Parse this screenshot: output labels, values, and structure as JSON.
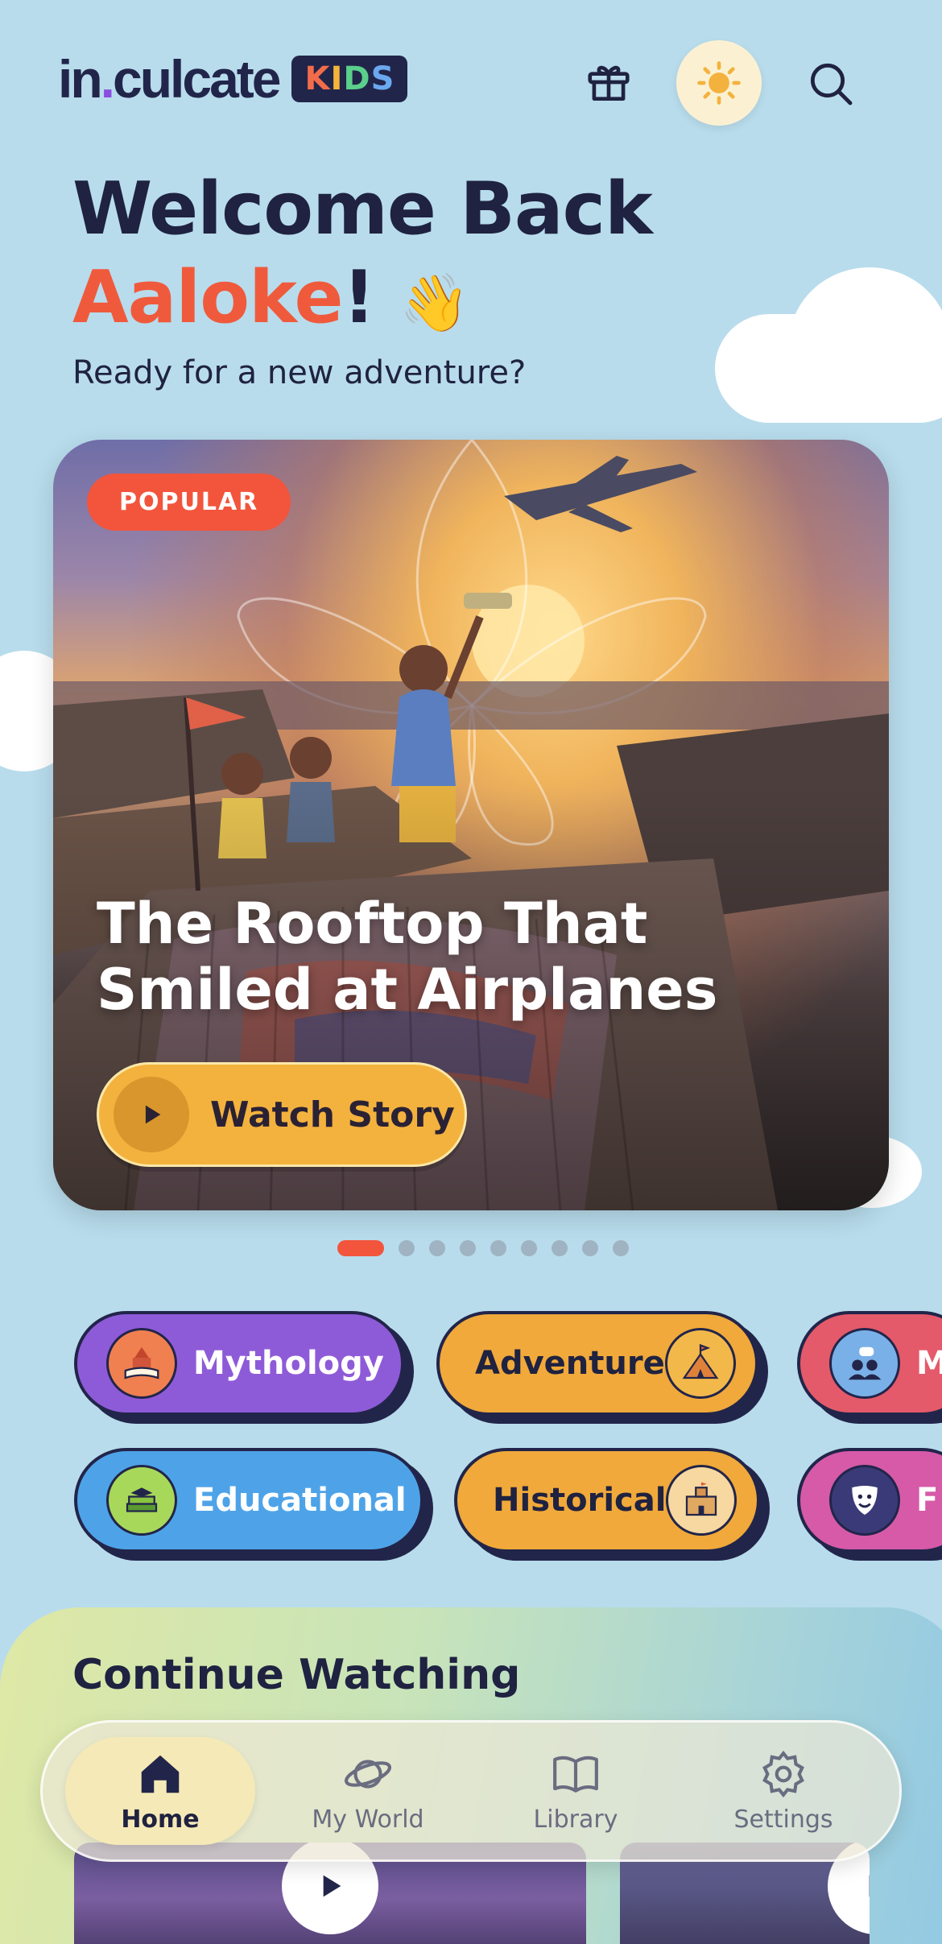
{
  "header": {
    "logo_main": "in",
    "logo_dot": ".",
    "logo_rest": "culcate",
    "logo_badge": [
      "K",
      "I",
      "D",
      "S"
    ],
    "icons": [
      "gift-icon",
      "sun-icon",
      "search-icon"
    ]
  },
  "welcome": {
    "line1": "Welcome Back",
    "name": "Aaloke",
    "exclaim": "!",
    "wave": "👋",
    "subtitle": "Ready for a new adventure?"
  },
  "hero": {
    "badge": "POPULAR",
    "title": "The Rooftop That Smiled at Airplanes",
    "button_label": "Watch Story",
    "carousel_pages": 9,
    "carousel_active_index": 0
  },
  "categories": {
    "mythology": "Mythology",
    "adventure": "Adventure",
    "third_partial": "M",
    "educational": "Educational",
    "historical": "Historical",
    "sixth_partial": "F"
  },
  "continue_watching": {
    "title": "Continue Watching"
  },
  "nav": {
    "home": "Home",
    "my_world": "My World",
    "library": "Library",
    "settings": "Settings",
    "active": "Home"
  },
  "colors": {
    "background": "#b8dcec",
    "accent_red": "#f2553c",
    "accent_yellow": "#f3b23e",
    "navy": "#22254a"
  }
}
